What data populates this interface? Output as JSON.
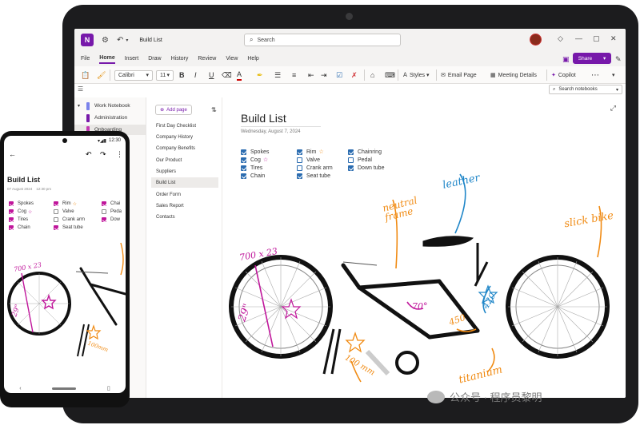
{
  "titlebar": {
    "doc_title": "Build List",
    "search_placeholder": "Search",
    "app_logo": "N"
  },
  "menu": {
    "items": [
      "File",
      "Home",
      "Insert",
      "Draw",
      "History",
      "Review",
      "View",
      "Help"
    ],
    "share_label": "Share"
  },
  "ribbon": {
    "font_name": "Calibri",
    "font_size": "11",
    "bold": "B",
    "italic": "I",
    "underline": "U",
    "styles_label": "Styles",
    "email_page_label": "Email Page",
    "meeting_details_label": "Meeting Details",
    "copilot_label": "Copilot"
  },
  "search_notebooks_placeholder": "Search notebooks",
  "notebooks": [
    {
      "label": "Work Notebook",
      "color": "#7b83eb"
    },
    {
      "label": "Administration",
      "color": "#7719aa"
    },
    {
      "label": "Onboarding",
      "color": "#c239b3"
    }
  ],
  "pages": {
    "add_label": "Add page",
    "items": [
      "First Day Checklist",
      "Company History",
      "Company Benefits",
      "Our Product",
      "Suppliers",
      "Build List",
      "Order Form",
      "Sales Report",
      "Contacts"
    ]
  },
  "page": {
    "title": "Build List",
    "date": "Wednesday, August 7, 2024",
    "col1": [
      {
        "label": "Spokes",
        "checked": true
      },
      {
        "label": "Cog",
        "checked": true
      },
      {
        "label": "Tires",
        "checked": true
      },
      {
        "label": "Chain",
        "checked": true
      }
    ],
    "col2": [
      {
        "label": "Rim",
        "checked": true
      },
      {
        "label": "Valve",
        "checked": false
      },
      {
        "label": "Crank arm",
        "checked": false
      },
      {
        "label": "Seat tube",
        "checked": true
      }
    ],
    "col3": [
      {
        "label": "Chainring",
        "checked": true
      },
      {
        "label": "Pedal",
        "checked": false
      },
      {
        "label": "Down tube",
        "checked": true
      }
    ],
    "annotations": {
      "leather": "leather",
      "neutral_frame": "neutral frame",
      "slick_bike": "slick bike",
      "wheel_size": "700 x 23",
      "wheel_inch": "29\"",
      "angle": "70°",
      "length_450": "450",
      "length_420": "420",
      "crank_100": "100 mm",
      "titanium": "titanium"
    }
  },
  "phone": {
    "status_time": "12:30",
    "title": "Build List",
    "date": "07 August 2024",
    "time": "12:30 pm",
    "col1": [
      "Spokes",
      "Cog",
      "Tires",
      "Chain"
    ],
    "col2": [
      "Rim",
      "Valve",
      "Crank arm",
      "Seat tube"
    ],
    "col3": [
      "Chai",
      "Peda",
      "Dow"
    ],
    "annotations": {
      "wheel_size": "700 x 23",
      "wheel_inch": "29\"",
      "crank": "100mm"
    }
  },
  "watermark": "公众号 · 程序员黎明",
  "colors": {
    "accent": "#7719aa",
    "check": "#2b6cb0",
    "ink_orange": "#f08a12",
    "ink_blue": "#1f86c8",
    "ink_magenta": "#c0169b"
  }
}
